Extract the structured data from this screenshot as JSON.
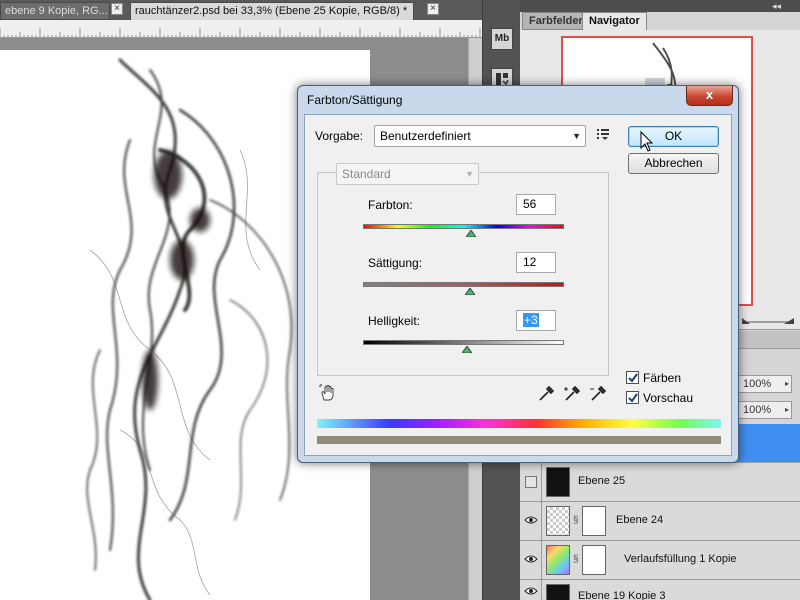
{
  "document_tabs": [
    {
      "label": "ebene 9 Kopie, RG...",
      "active": false
    },
    {
      "label": "rauchtänzer2.psd bei 33,3% (Ebene 25 Kopie, RGB/8) *",
      "active": true
    }
  ],
  "dock": {
    "mini_bridge_label": "Mb"
  },
  "panels": {
    "tabs": [
      {
        "label": "Farbfelder",
        "active": false
      },
      {
        "label": "Navigator",
        "active": true
      }
    ],
    "opacity_top": "100%",
    "fill_value": "100%"
  },
  "layers": [
    {
      "name": "Ebene 25",
      "visible": false,
      "thumb": "dark"
    },
    {
      "name": "Ebene 24",
      "visible": true,
      "thumb": "checker"
    },
    {
      "name": "Verlaufsfüllung 1 Kopie",
      "visible": true,
      "thumb": "gradient"
    },
    {
      "name": "Ebene 19 Kopie 3",
      "visible": true,
      "thumb": "dark"
    }
  ],
  "dialog": {
    "title": "Farbton/Sättigung",
    "close_label": "x",
    "preset_label": "Vorgabe:",
    "preset_value": "Benutzerdefiniert",
    "ok_label": "OK",
    "cancel_label": "Abbrechen",
    "channel_value": "Standard",
    "hue_label": "Farbton:",
    "hue_value": "56",
    "hue_position": 0.535,
    "saturation_label": "Sättigung:",
    "saturation_value": "12",
    "saturation_position": 0.53,
    "lightness_label": "Helligkeit:",
    "lightness_value": "+3",
    "lightness_position": 0.515,
    "colorize_label": "Färben",
    "colorize_checked": true,
    "preview_label": "Vorschau",
    "preview_checked": true,
    "result_color": "#8f8b78"
  }
}
